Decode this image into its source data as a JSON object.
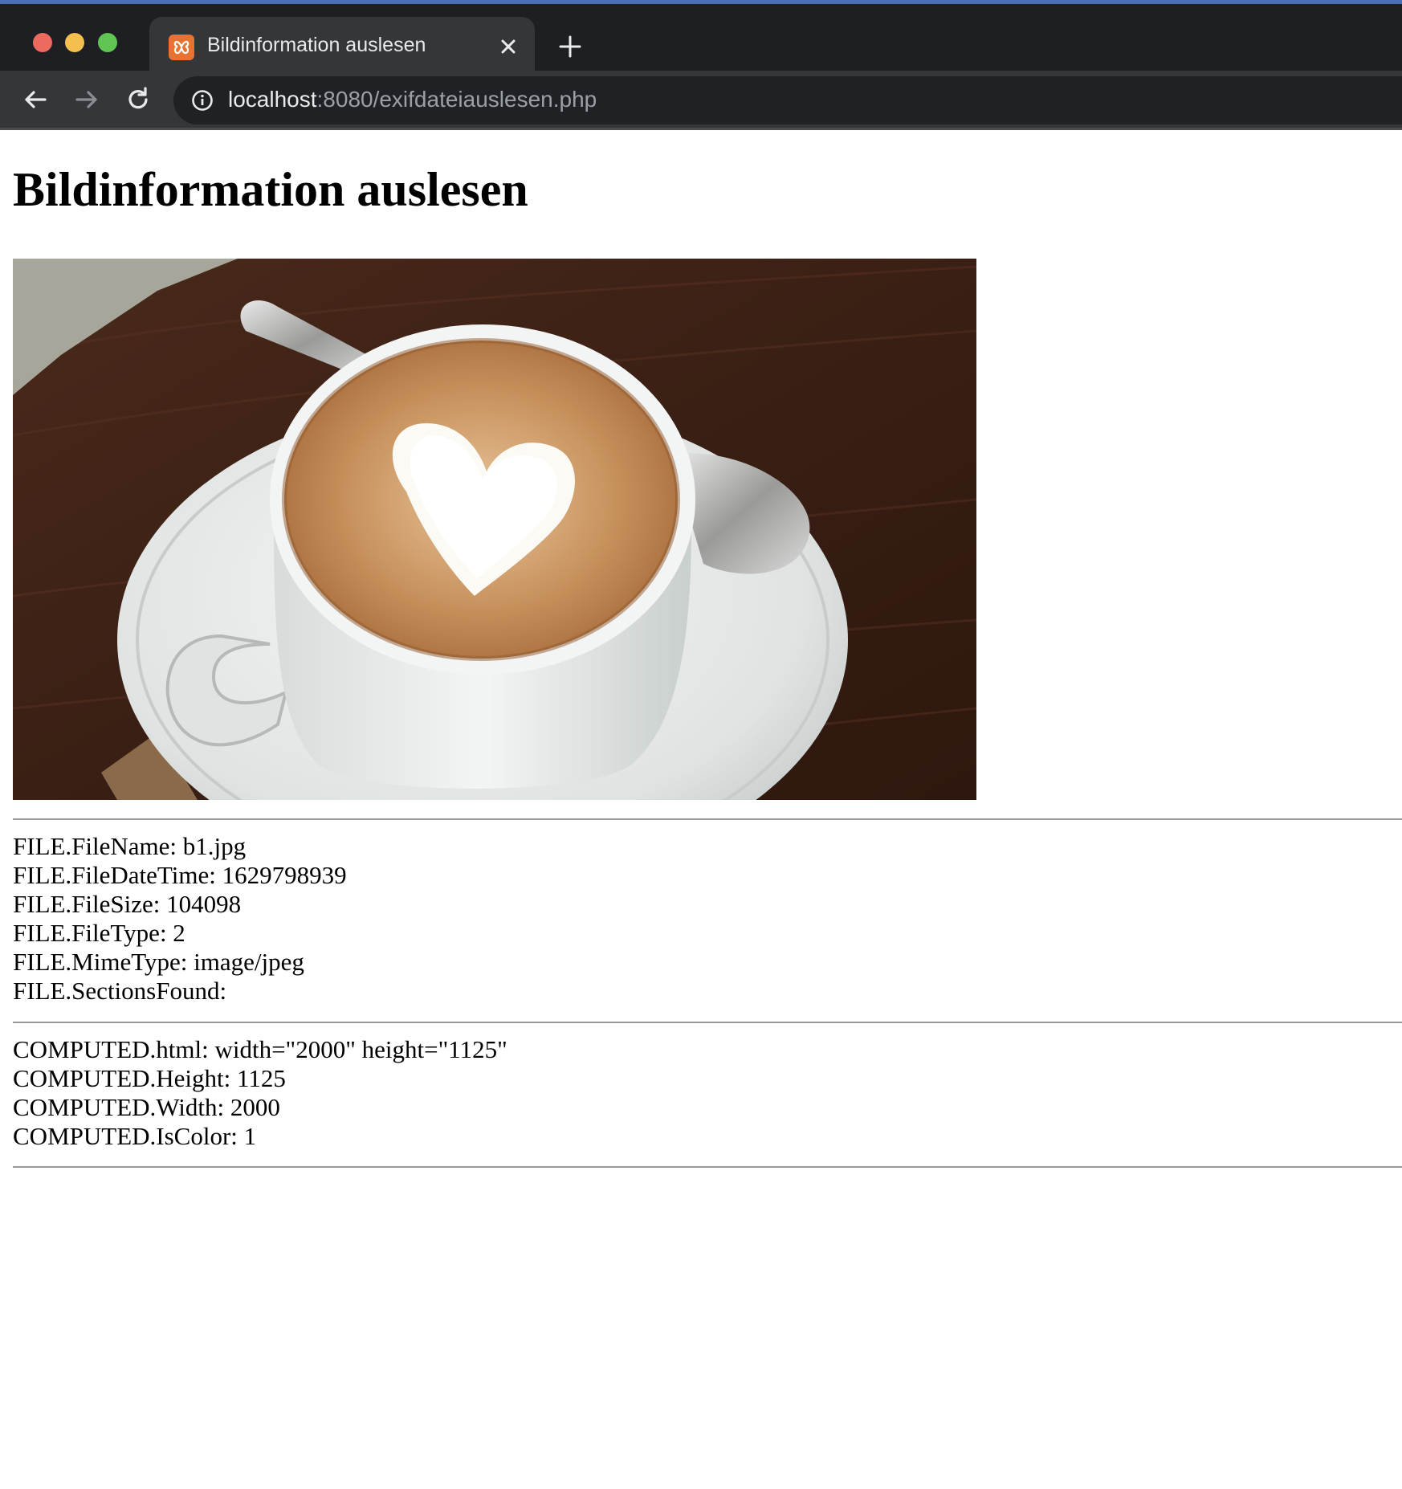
{
  "browser": {
    "tab_title": "Bildinformation auslesen",
    "url_host": "localhost",
    "url_rest": ":8080/exifdateiauslesen.php",
    "favicon": "xampp-icon",
    "colors": {
      "tabbar": "#1e1f22",
      "toolbar": "#35363a",
      "omnibox": "#202124",
      "favicon": "#e8722f"
    }
  },
  "page": {
    "heading": "Bildinformation auslesen",
    "image": "coffee-cup-photo",
    "file_info": [
      "FILE.FileName: b1.jpg",
      "FILE.FileDateTime: 1629798939",
      "FILE.FileSize: 104098",
      "FILE.FileType: 2",
      "FILE.MimeType: image/jpeg",
      "FILE.SectionsFound:"
    ],
    "computed_info": [
      "COMPUTED.html: width=\"2000\" height=\"1125\"",
      "COMPUTED.Height: 1125",
      "COMPUTED.Width: 2000",
      "COMPUTED.IsColor: 1"
    ]
  }
}
